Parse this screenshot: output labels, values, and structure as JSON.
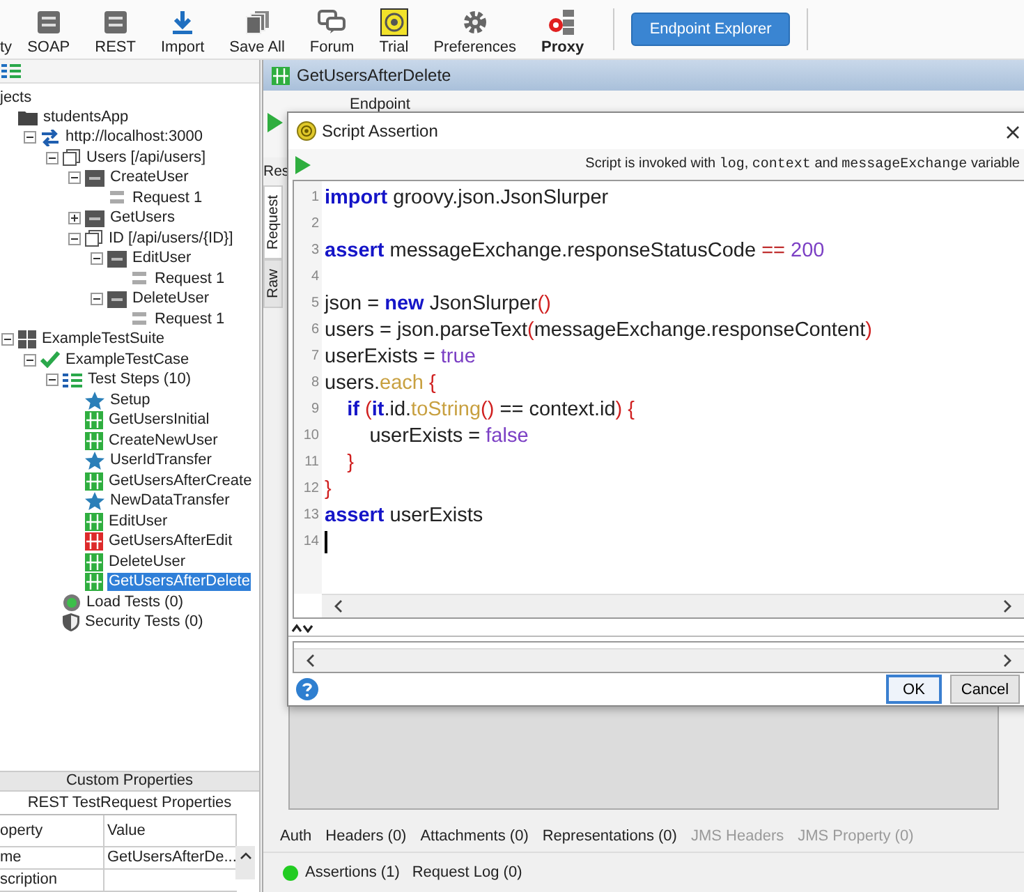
{
  "toolbar": {
    "items": [
      {
        "label": "ty",
        "kind": "none",
        "bold": false
      },
      {
        "label": "SOAP",
        "kind": "soap",
        "bold": false
      },
      {
        "label": "REST",
        "kind": "rest",
        "bold": false
      },
      {
        "label": "Import",
        "kind": "import",
        "bold": false
      },
      {
        "label": "Save All",
        "kind": "saveall",
        "bold": false
      },
      {
        "label": "Forum",
        "kind": "forum",
        "bold": false
      },
      {
        "label": "Trial",
        "kind": "trial",
        "bold": false
      },
      {
        "label": "Preferences",
        "kind": "gear",
        "bold": false
      },
      {
        "label": "Proxy",
        "kind": "proxy",
        "bold": true
      }
    ],
    "button": "Endpoint Explorer"
  },
  "navigator": {
    "header": "jects",
    "tree": [
      {
        "label": "studentsApp",
        "kind": "folder",
        "selected": false,
        "children": [
          {
            "label": "http://localhost:3000",
            "kind": "service",
            "expanded": true,
            "selected": false,
            "children": [
              {
                "label": "Users [/api/users]",
                "kind": "resource",
                "expanded": true,
                "selected": false,
                "children": [
                  {
                    "label": "CreateUser",
                    "kind": "post",
                    "expanded": true,
                    "selected": false,
                    "children": [
                      {
                        "label": "Request 1",
                        "kind": "request",
                        "selected": false
                      }
                    ]
                  },
                  {
                    "label": "GetUsers",
                    "kind": "get",
                    "expanded": false,
                    "selected": false
                  },
                  {
                    "label": "ID [/api/users/{ID}]",
                    "kind": "resource",
                    "expanded": true,
                    "selected": false,
                    "children": [
                      {
                        "label": "EditUser",
                        "kind": "put",
                        "expanded": true,
                        "selected": false,
                        "children": [
                          {
                            "label": "Request 1",
                            "kind": "request",
                            "selected": false
                          }
                        ]
                      },
                      {
                        "label": "DeleteUser",
                        "kind": "delete",
                        "expanded": true,
                        "selected": false,
                        "children": [
                          {
                            "label": "Request 1",
                            "kind": "request",
                            "selected": false
                          }
                        ]
                      }
                    ]
                  }
                ]
              }
            ]
          }
        ]
      },
      {
        "label": "ExampleTestSuite",
        "kind": "suite",
        "expanded": true,
        "selected": false,
        "children": [
          {
            "label": "ExampleTestCase",
            "kind": "testcase",
            "expanded": true,
            "selected": false,
            "children": [
              {
                "label": "Test Steps (10)",
                "kind": "steps",
                "expanded": true,
                "selected": false,
                "children": [
                  {
                    "label": "Setup",
                    "kind": "star",
                    "selected": false
                  },
                  {
                    "label": "GetUsersInitial",
                    "kind": "rest-pass",
                    "selected": false
                  },
                  {
                    "label": "CreateNewUser",
                    "kind": "rest-pass",
                    "selected": false
                  },
                  {
                    "label": "UserIdTransfer",
                    "kind": "star",
                    "selected": false
                  },
                  {
                    "label": "GetUsersAfterCreate",
                    "kind": "rest-pass",
                    "selected": false
                  },
                  {
                    "label": "NewDataTransfer",
                    "kind": "star",
                    "selected": false
                  },
                  {
                    "label": "EditUser",
                    "kind": "rest-pass",
                    "selected": false
                  },
                  {
                    "label": "GetUsersAfterEdit",
                    "kind": "rest-fail",
                    "selected": false
                  },
                  {
                    "label": "DeleteUser",
                    "kind": "rest-pass",
                    "selected": false
                  },
                  {
                    "label": "GetUsersAfterDelete",
                    "kind": "rest-pass",
                    "selected": true
                  }
                ]
              },
              {
                "label": "Load Tests (0)",
                "kind": "load",
                "selected": false
              },
              {
                "label": "Security Tests (0)",
                "kind": "security",
                "selected": false
              }
            ]
          }
        ]
      }
    ]
  },
  "properties": {
    "title": "Custom Properties",
    "subtitle": "REST TestRequest Properties",
    "columns": [
      "operty",
      "Value"
    ],
    "rows": [
      {
        "cells": [
          "me",
          "GetUsersAfterDe..."
        ]
      },
      {
        "cells": [
          "scription"
        ]
      }
    ]
  },
  "editor": {
    "title": "GetUsersAfterDelete",
    "endpoint_label": "Endpoint",
    "side_tab": "Res",
    "vertical_tabs": [
      {
        "label": "Request",
        "selected": true
      },
      {
        "label": "Raw",
        "selected": false
      }
    ],
    "bottom_tabs": [
      {
        "label": "Auth",
        "disabled": false
      },
      {
        "label": "Headers (0)",
        "disabled": false
      },
      {
        "label": "Attachments (0)",
        "disabled": false
      },
      {
        "label": "Representations (0)",
        "disabled": false
      },
      {
        "label": "JMS Headers",
        "disabled": true
      },
      {
        "label": "JMS Property (0)",
        "disabled": true
      }
    ],
    "status_tabs": [
      {
        "label": "Assertions (1)",
        "color": "#22cc22"
      },
      {
        "label": "Request Log (0)"
      }
    ]
  },
  "dialog": {
    "title": "Script Assertion",
    "info": [
      {
        "text": "Script is invoked with ",
        "kind": "plain"
      },
      {
        "text": "log",
        "kind": "code"
      },
      {
        "text": ", ",
        "kind": "plain"
      },
      {
        "text": "context",
        "kind": "code"
      },
      {
        "text": " and ",
        "kind": "plain"
      },
      {
        "text": "messageExchange",
        "kind": "code"
      },
      {
        "text": " variable",
        "kind": "plain"
      }
    ],
    "code": [
      {
        "number": "1",
        "tokens": [
          {
            "kind": "keyword",
            "text": "import"
          },
          {
            "kind": "plain",
            "text": " groovy.json.JsonSlurper"
          }
        ]
      },
      {
        "number": "2"
      },
      {
        "number": "3",
        "tokens": [
          {
            "kind": "keyword",
            "text": "assert"
          },
          {
            "kind": "plain",
            "text": " messageExchange.responseStatusCode "
          },
          {
            "kind": "operator",
            "text": "=="
          },
          {
            "kind": "literal",
            "text": " 200"
          }
        ]
      },
      {
        "number": "4"
      },
      {
        "number": "5",
        "tokens": [
          {
            "kind": "plain",
            "text": "json = "
          },
          {
            "kind": "keyword",
            "text": "new"
          },
          {
            "kind": "plain",
            "text": " JsonSlurper"
          },
          {
            "kind": "bracket",
            "text": "()"
          }
        ]
      },
      {
        "number": "6",
        "tokens": [
          {
            "kind": "plain",
            "text": "users = json.parseText"
          },
          {
            "kind": "bracket",
            "text": "("
          },
          {
            "kind": "plain",
            "text": "messageExchange.responseContent"
          },
          {
            "kind": "bracket",
            "text": ")"
          }
        ]
      },
      {
        "number": "7",
        "tokens": [
          {
            "kind": "plain",
            "text": "userExists = "
          },
          {
            "kind": "literal",
            "text": "true"
          }
        ]
      },
      {
        "number": "8",
        "tokens": [
          {
            "kind": "plain",
            "text": "users."
          },
          {
            "kind": "method",
            "text": "each"
          },
          {
            "kind": "bracket",
            "text": " {"
          }
        ]
      },
      {
        "number": "9",
        "tokens": [
          {
            "kind": "keyword",
            "text": "    if"
          },
          {
            "kind": "bracket",
            "text": " ("
          },
          {
            "kind": "keyword",
            "text": "it"
          },
          {
            "kind": "plain",
            "text": ".id."
          },
          {
            "kind": "method",
            "text": "toString"
          },
          {
            "kind": "bracket",
            "text": "()"
          },
          {
            "kind": "plain",
            "text": " == context.id"
          },
          {
            "kind": "bracket",
            "text": ")"
          },
          {
            "kind": "bracket",
            "text": " {"
          }
        ]
      },
      {
        "number": "10",
        "tokens": [
          {
            "kind": "plain",
            "text": "        userExists = "
          },
          {
            "kind": "literal",
            "text": "false"
          }
        ]
      },
      {
        "number": "11",
        "tokens": [
          {
            "kind": "bracket",
            "text": "    }"
          }
        ]
      },
      {
        "number": "12",
        "tokens": [
          {
            "kind": "bracket",
            "text": "}"
          }
        ]
      },
      {
        "number": "13",
        "tokens": [
          {
            "kind": "keyword",
            "text": "assert"
          },
          {
            "kind": "plain",
            "text": " userExists"
          }
        ]
      },
      {
        "number": "14",
        "cursor": true
      }
    ],
    "buttons": [
      {
        "label": "OK",
        "default": true
      },
      {
        "label": "Cancel",
        "default": false
      }
    ]
  }
}
